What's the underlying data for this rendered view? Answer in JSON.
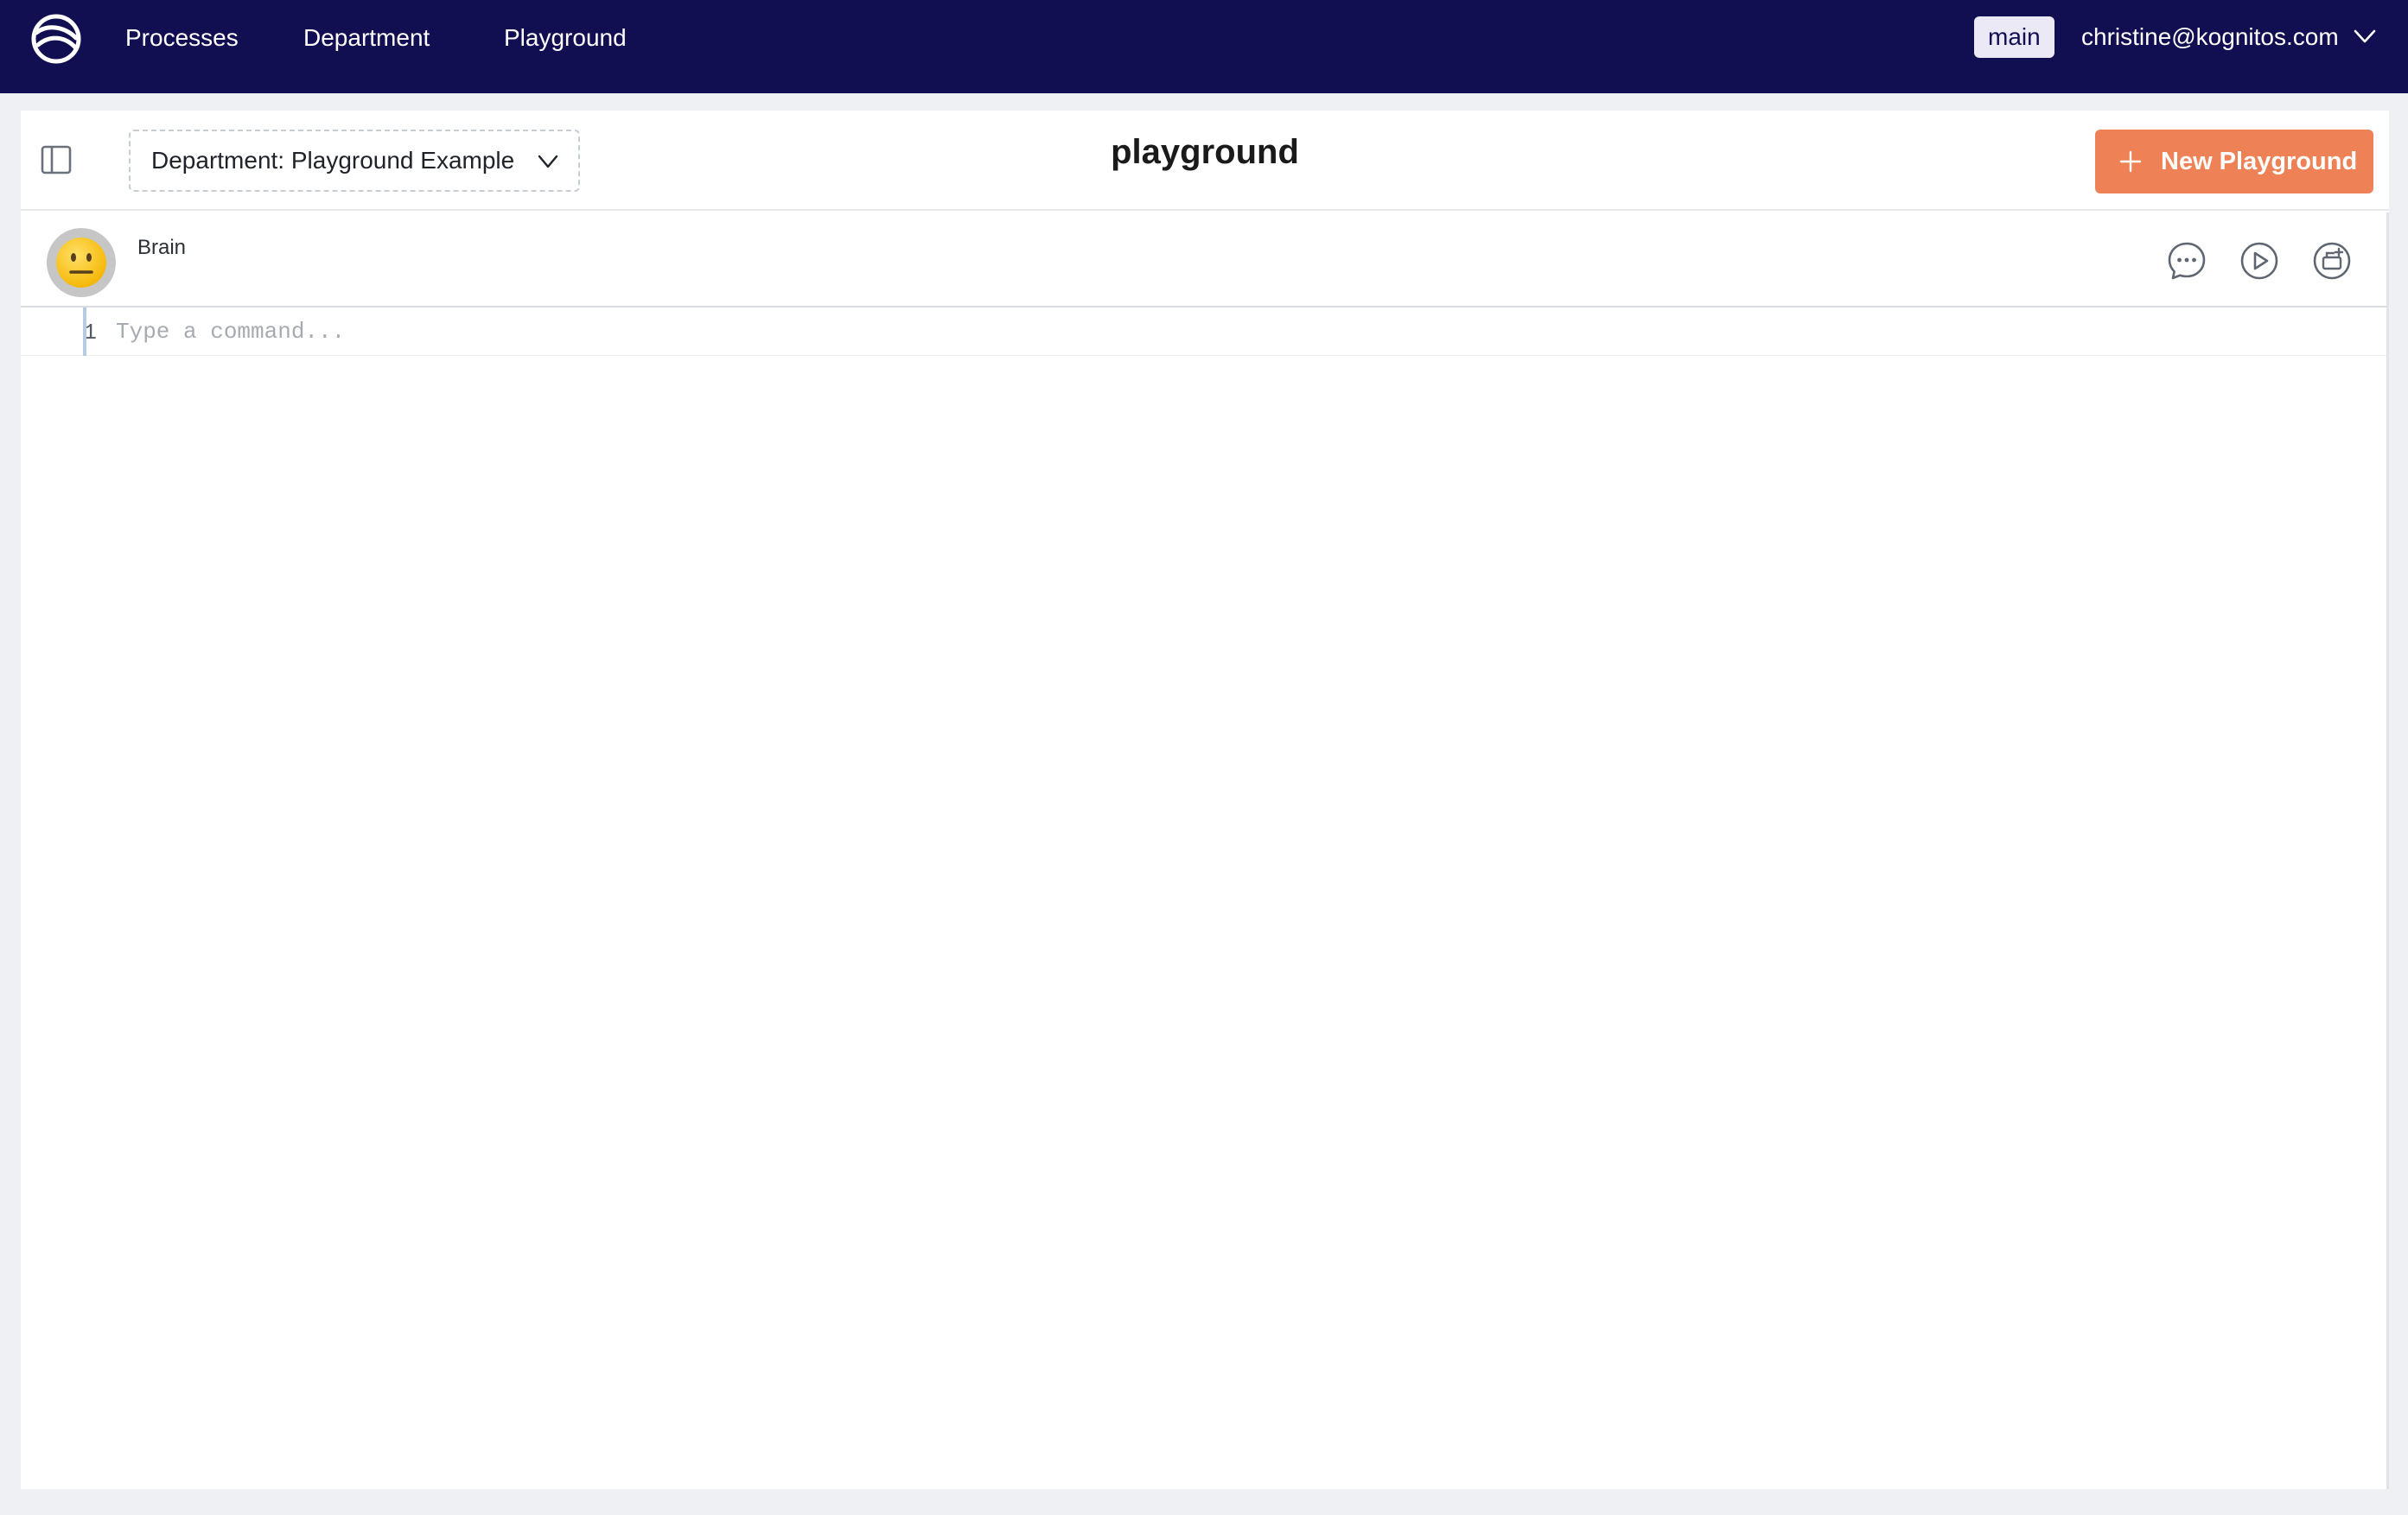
{
  "nav": {
    "logo_icon": "kognitos-logo-icon",
    "links": [
      "Processes",
      "Department",
      "Playground"
    ],
    "branch": "main",
    "user_email": "christine@kognitos.com",
    "user_menu_icon": "chevron-down-icon"
  },
  "header": {
    "sidebar_toggle_icon": "sidebar-toggle-icon",
    "department_select": "Department: Playground Example",
    "title": "playground",
    "new_button_label": "New Playground",
    "new_button_icon": "plus-icon"
  },
  "editor": {
    "avatar_icon": "neutral-face-icon",
    "agent_name": "Brain",
    "toolbar_icons": [
      "chat-bubble-icon",
      "play-icon",
      "add-document-icon"
    ],
    "line_number": "1",
    "placeholder": "Type a command..."
  },
  "colors": {
    "nav_background": "#120e52",
    "accent": "#ee8256",
    "page_background": "#eef0f4"
  }
}
